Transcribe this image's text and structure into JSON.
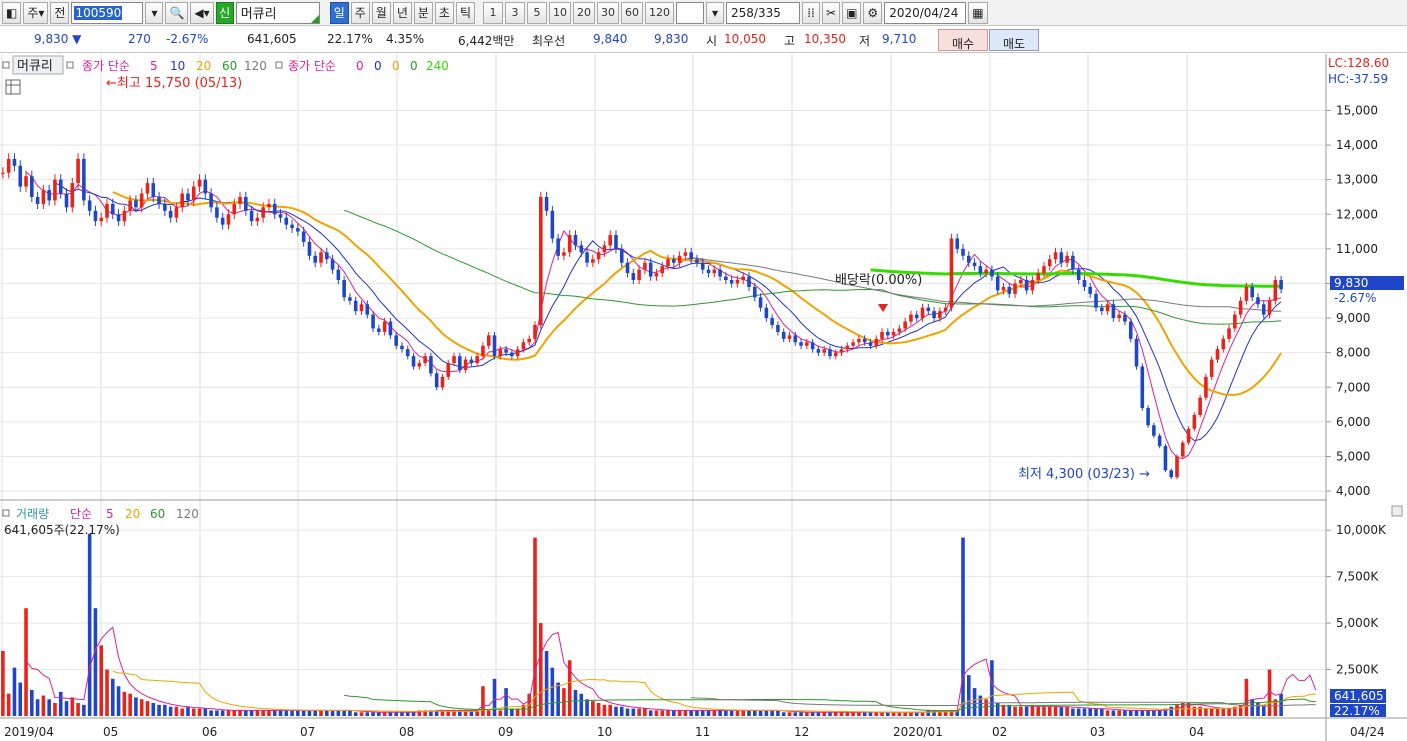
{
  "toolbar": {
    "type_label": "주",
    "jeon_label": "전",
    "code": "100590",
    "shin_label": "신",
    "name": "머큐리",
    "periods": [
      "일",
      "주",
      "월",
      "년",
      "분",
      "초",
      "틱"
    ],
    "numbers": [
      "1",
      "3",
      "5",
      "10",
      "20",
      "30",
      "60",
      "120"
    ],
    "count": "258",
    "total": "/335",
    "date": "2020/04/24"
  },
  "quote": {
    "price": "9,830",
    "change": "270",
    "change_pct": "-2.67%",
    "volume": "641,605",
    "vol_pct": "22.17%",
    "turnover_pct": "4.35%",
    "amount": "6,442백만",
    "best_label": "최우선",
    "best_ask": "9,840",
    "best_bid": "9,830",
    "open_label": "시",
    "open": "10,050",
    "high_label": "고",
    "high": "10,350",
    "low_label": "저",
    "low": "9,710",
    "buy_label": "매수",
    "sell_label": "매도"
  },
  "legend": {
    "name": "머큐리",
    "ma_label": "종가 단순",
    "ma_periods": [
      "5",
      "10",
      "20",
      "60",
      "120"
    ],
    "ma2_label": "종가 단순",
    "ma2_periods": [
      "0",
      "0",
      "0",
      "0",
      "240"
    ],
    "vol_label": "거래량",
    "vol_ma_label": "단순",
    "vol_ma_periods": [
      "5",
      "20",
      "60",
      "120"
    ],
    "vol_value": "641,605주(22.17%)"
  },
  "annotations": {
    "high": "최고 15,750 (05/13)",
    "low": "최저 4,300 (03/23)",
    "dividend": "배당락(0.00%)"
  },
  "right_axis": {
    "lc": "LC:128.60",
    "hc": "HC:-37.59",
    "price_tag": "9,830",
    "pct_tag": "-2.67%",
    "vol_tag": "641,605",
    "vol_pct_tag": "22.17%",
    "last_date": "04/24"
  },
  "colors": {
    "up": "#e8231a",
    "down": "#1f46c8",
    "ma5": "#e0209a",
    "ma10": "#2233cc",
    "ma20": "#f3a300",
    "ma60": "#2a9a2a",
    "ma120": "#7a7a7a",
    "ma240": "#33dd00"
  },
  "chart_data": {
    "type": "candlestick",
    "x_ticks": [
      "2019/04",
      "05",
      "06",
      "07",
      "08",
      "09",
      "10",
      "11",
      "12",
      "2020/01",
      "02",
      "03",
      "04"
    ],
    "price_ticks": [
      15000,
      14000,
      13000,
      12000,
      11000,
      10000,
      9000,
      8000,
      7000,
      6000,
      5000,
      4000
    ],
    "volume_ticks": [
      "10,000K",
      "7,500K",
      "5,000K",
      "2,500K"
    ],
    "price_range": [
      3800,
      16400
    ],
    "volume_range": [
      0,
      11300
    ],
    "price_series": [
      13200,
      13600,
      13400,
      12800,
      13100,
      12500,
      12300,
      12700,
      12400,
      13000,
      12600,
      12200,
      12900,
      13600,
      12400,
      12100,
      11800,
      11900,
      12300,
      12000,
      11800,
      12100,
      12400,
      12200,
      12600,
      12900,
      12500,
      12300,
      12100,
      11900,
      12200,
      12600,
      12400,
      12800,
      13000,
      12600,
      12200,
      11900,
      11700,
      12000,
      12300,
      12500,
      12100,
      11800,
      11900,
      12200,
      12300,
      12000,
      11900,
      11700,
      11600,
      11500,
      11200,
      10800,
      10600,
      10900,
      10700,
      10400,
      10100,
      9600,
      9500,
      9200,
      9400,
      9100,
      8700,
      8600,
      8900,
      8500,
      8200,
      8100,
      7900,
      7600,
      7700,
      7900,
      7400,
      7000,
      7300,
      7700,
      7900,
      7500,
      7800,
      7700,
      7900,
      8200,
      8500,
      7900,
      8100,
      8000,
      7900,
      8100,
      8300,
      8400,
      8800,
      12500,
      12100,
      11300,
      10800,
      10900,
      11400,
      11100,
      10900,
      10600,
      10700,
      10900,
      11100,
      11400,
      11000,
      10600,
      10300,
      10100,
      10400,
      10600,
      10200,
      10300,
      10500,
      10700,
      10600,
      10800,
      10900,
      10700,
      10600,
      10400,
      10300,
      10400,
      10200,
      10100,
      10000,
      10100,
      10200,
      9900,
      9600,
      9300,
      9000,
      8800,
      8600,
      8400,
      8500,
      8300,
      8200,
      8300,
      8100,
      8000,
      8100,
      7900,
      8000,
      8100,
      8200,
      8300,
      8400,
      8300,
      8200,
      8400,
      8600,
      8500,
      8600,
      8700,
      8900,
      9100,
      9000,
      9300,
      9200,
      9000,
      9200,
      9300,
      11300,
      11000,
      10800,
      10600,
      10500,
      10300,
      10400,
      10200,
      9800,
      9900,
      9700,
      10000,
      10100,
      9800,
      10100,
      10300,
      10500,
      10700,
      10900,
      10600,
      10800,
      10400,
      10100,
      9900,
      9700,
      9300,
      9200,
      9400,
      9000,
      9100,
      8900,
      8400,
      7600,
      6400,
      5900,
      5600,
      5300,
      4600,
      4400,
      5000,
      5400,
      5800,
      6200,
      6700,
      7300,
      7800,
      8100,
      8400,
      8700,
      9100,
      9500,
      9900,
      9600,
      9400,
      9100,
      9500,
      10100,
      9830
    ],
    "volume_series": [
      3500,
      1200,
      2600,
      1800,
      5800,
      1400,
      900,
      1100,
      900,
      700,
      1300,
      800,
      1000,
      700,
      600,
      9800,
      5800,
      3800,
      2500,
      2000,
      1600,
      1300,
      1200,
      1000,
      900,
      800,
      700,
      600,
      600,
      500,
      500,
      400,
      500,
      400,
      400,
      400,
      300,
      300,
      300,
      300,
      300,
      300,
      300,
      300,
      300,
      300,
      300,
      300,
      300,
      300,
      300,
      300,
      300,
      300,
      300,
      300,
      300,
      300,
      300,
      300,
      300,
      200,
      200,
      200,
      200,
      200,
      200,
      200,
      200,
      200,
      200,
      200,
      300,
      300,
      300,
      300,
      300,
      300,
      300,
      300,
      300,
      300,
      300,
      1600,
      300,
      2000,
      300,
      1500,
      400,
      400,
      600,
      1200,
      9600,
      5000,
      3500,
      2600,
      1800,
      1500,
      3000,
      1400,
      1200,
      900,
      800,
      700,
      600,
      600,
      500,
      500,
      400,
      400,
      400,
      400,
      300,
      300,
      300,
      300,
      300,
      300,
      300,
      300,
      300,
      300,
      300,
      300,
      300,
      300,
      300,
      300,
      300,
      300,
      300,
      300,
      300,
      300,
      300,
      200,
      200,
      200,
      200,
      200,
      200,
      200,
      200,
      200,
      200,
      200,
      200,
      200,
      200,
      200,
      200,
      200,
      200,
      200,
      200,
      200,
      200,
      200,
      200,
      200,
      300,
      300,
      300,
      300,
      300,
      300,
      9600,
      2200,
      1500,
      1100,
      900,
      3000,
      700,
      600,
      600,
      500,
      500,
      500,
      600,
      500,
      500,
      500,
      500,
      500,
      500,
      400,
      400,
      400,
      400,
      400,
      400,
      300,
      300,
      300,
      300,
      300,
      300,
      300,
      300,
      300,
      300,
      400,
      500,
      600,
      700,
      700,
      500,
      500,
      400,
      400,
      400,
      400,
      400,
      500,
      600,
      2000,
      900,
      700,
      600,
      2500,
      900,
      1200,
      4700,
      1900,
      900,
      800,
      2700,
      641
    ]
  }
}
